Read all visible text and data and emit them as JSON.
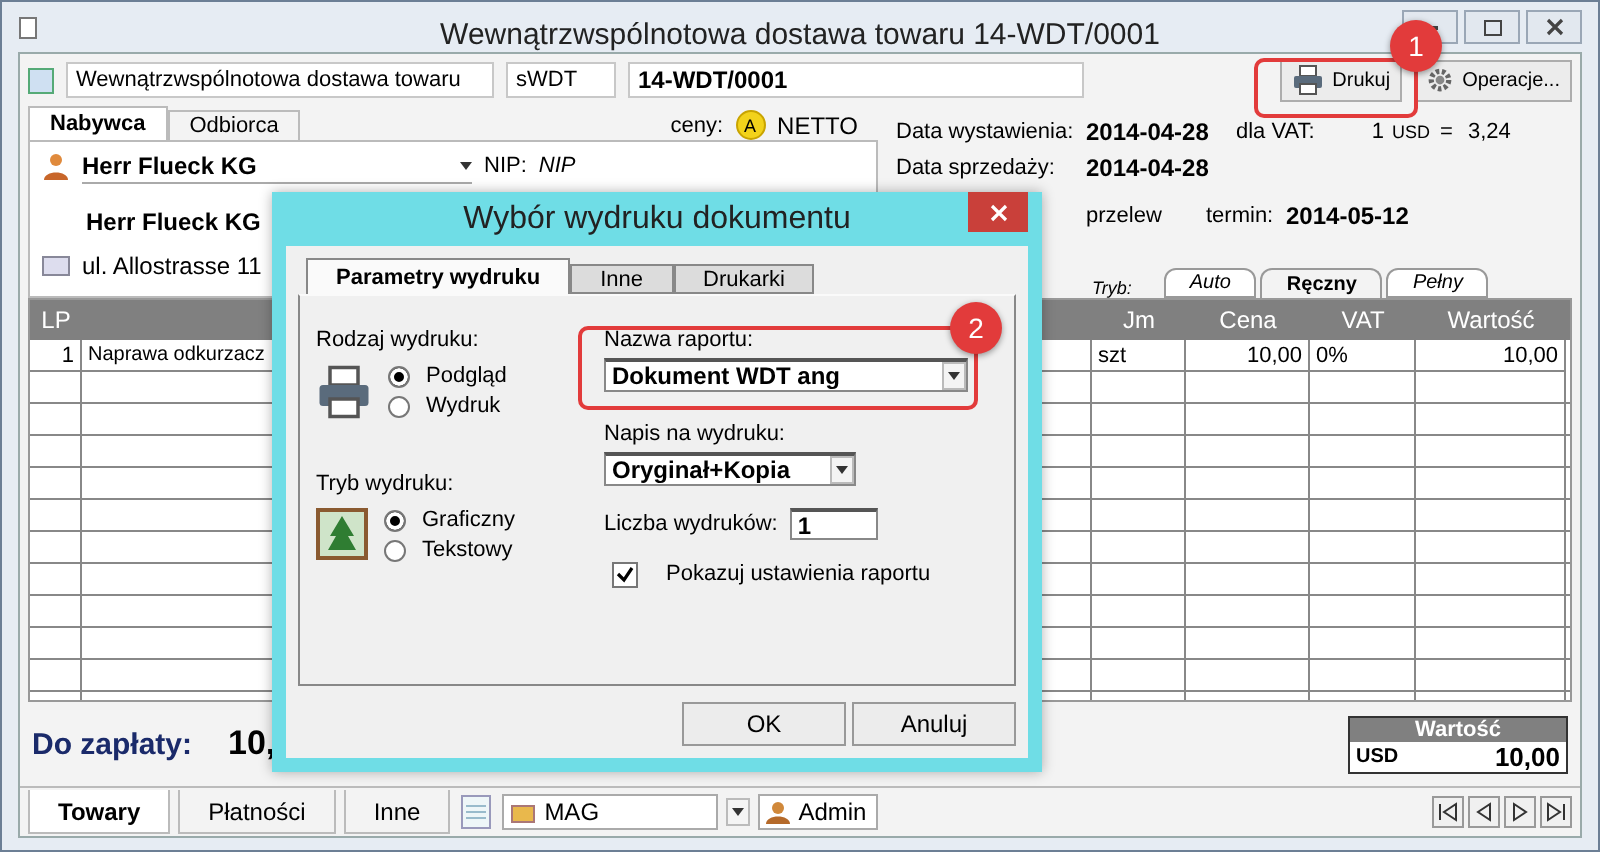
{
  "window": {
    "title": "Wewnątrzwspólnotowa dostawa towaru 14-WDT/0001"
  },
  "document": {
    "type": "Wewnątrzwspólnotowa dostawa towaru",
    "series": "sWDT",
    "number": "14-WDT/0001"
  },
  "toolbar": [
    {
      "label": "Drukuj",
      "kind": "print"
    },
    {
      "label": "Operacje...",
      "kind": "gear"
    }
  ],
  "party_tabs": [
    {
      "label": "Nabywca",
      "selected": true
    },
    {
      "label": "Odbiorca",
      "selected": false
    }
  ],
  "prices": {
    "label": "ceny:",
    "badge": "A",
    "value": "NETTO"
  },
  "customer": {
    "name": "Herr Flueck KG",
    "nip_label": "NIP:",
    "nip": "NIP",
    "full_name": "Herr Flueck KG",
    "address": "ul. Allostrasse 11"
  },
  "info": {
    "issue_label": "Data wystawienia:",
    "issue_date": "2014-04-28",
    "vat_label": "dla VAT:",
    "rate": "1",
    "currency": "USD",
    "equals": "=",
    "rate_value": "3,24",
    "sale_label": "Data sprzedaży:",
    "sale_date": "2014-04-28",
    "payment": "przelew",
    "due_label": "termin:",
    "due_date": "2014-05-12"
  },
  "mode": {
    "label": "Tryb:",
    "tabs": [
      {
        "label": "Auto",
        "selected": false
      },
      {
        "label": "Ręczny",
        "selected": true
      },
      {
        "label": "Pełny",
        "selected": false
      }
    ]
  },
  "table": {
    "columns": [
      "LP",
      null,
      "Jm",
      "Cena",
      "VAT",
      "Wartość"
    ],
    "rows": [
      {
        "cells": [
          "1",
          "Naprawa odkurzacz",
          "szt",
          "10,00",
          "0%",
          "10,00"
        ]
      }
    ]
  },
  "total": {
    "label": "Do zapłaty:",
    "value": "10,"
  },
  "summary": {
    "title": "Wartość",
    "currency": "USD",
    "value": "10,00"
  },
  "bottom_tabs": [
    {
      "label": "Towary",
      "selected": true
    },
    {
      "label": "Płatności",
      "selected": false
    },
    {
      "label": "Inne",
      "selected": false
    }
  ],
  "warehouse": "MAG",
  "user": "Admin",
  "dialog": {
    "title": "Wybór wydruku dokumentu",
    "tabs": [
      {
        "label": "Parametry wydruku",
        "selected": true
      },
      {
        "label": "Inne",
        "selected": false
      },
      {
        "label": "Drukarki",
        "selected": false
      }
    ],
    "print_type": {
      "label": "Rodzaj wydruku:",
      "options": [
        {
          "label": "Podgląd",
          "selected": true
        },
        {
          "label": "Wydruk",
          "selected": false
        }
      ]
    },
    "print_mode": {
      "label": "Tryb wydruku:",
      "options": [
        {
          "label": "Graficzny",
          "selected": true
        },
        {
          "label": "Tekstowy",
          "selected": false
        }
      ]
    },
    "report": {
      "label": "Nazwa raportu:",
      "value": "Dokument WDT ang"
    },
    "caption": {
      "label": "Napis na wydruku:",
      "value": "Oryginał+Kopia"
    },
    "copies": {
      "label": "Liczba wydruków:",
      "value": "1"
    },
    "show_settings": {
      "label": "Pokazuj ustawienia raportu",
      "checked": true
    },
    "buttons": [
      "OK",
      "Anuluj"
    ]
  },
  "annotations": [
    {
      "number": "1"
    },
    {
      "number": "2"
    }
  ]
}
